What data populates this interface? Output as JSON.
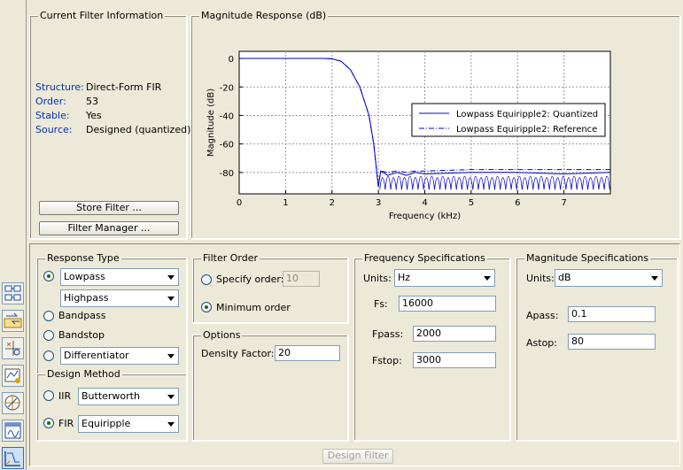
{
  "filter_info": {
    "title": "Current Filter Information",
    "rows": [
      {
        "key": "Structure:",
        "value": "Direct-Form FIR"
      },
      {
        "key": "Order:",
        "value": "53"
      },
      {
        "key": "Stable:",
        "value": "Yes"
      },
      {
        "key": "Source:",
        "value": "Designed (quantized)"
      }
    ],
    "store_filter_label": "Store Filter ...",
    "filter_manager_label": "Filter Manager ..."
  },
  "magnitude_panel": {
    "title": "Magnitude Response (dB)"
  },
  "chart_data": {
    "type": "line",
    "title": "",
    "xlabel": "Frequency (kHz)",
    "ylabel": "Magnitude (dB)",
    "xlim": [
      0,
      8
    ],
    "ylim": [
      -95,
      5
    ],
    "xticks": [
      "0",
      "1",
      "2",
      "3",
      "4",
      "5",
      "6",
      "7"
    ],
    "yticks": [
      "0",
      "-20",
      "-40",
      "-60",
      "-80"
    ],
    "grid": true,
    "legend_position": "center-right",
    "series": [
      {
        "name": "Lowpass Equiripple2: Quantized",
        "style": "solid",
        "color": "#0000cc",
        "x": [
          0,
          1,
          1.8,
          2.0,
          2.2,
          2.4,
          2.6,
          2.8,
          2.9,
          3.0,
          3.05,
          3.2,
          3.4,
          3.6,
          3.8,
          4.0,
          5.0,
          6.0,
          7.0,
          8.0
        ],
        "y": [
          0,
          0,
          0,
          -0.2,
          -2,
          -8,
          -20,
          -40,
          -60,
          -90,
          -79,
          -82,
          -80,
          -82,
          -80,
          -81,
          -80,
          -80,
          -81,
          -80
        ]
      },
      {
        "name": "Lowpass Equiripple2: Reference",
        "style": "dashdot",
        "color": "#0000cc",
        "x": [
          0,
          1,
          1.8,
          2.0,
          2.2,
          2.4,
          2.6,
          2.8,
          2.9,
          3.0,
          3.05,
          3.2,
          3.4,
          3.6,
          3.8,
          4.0,
          5.0,
          6.0,
          7.0,
          8.0
        ],
        "y": [
          0,
          0,
          0,
          -0.2,
          -2,
          -8,
          -20,
          -40,
          -60,
          -90,
          -79,
          -80,
          -79,
          -80,
          -79,
          -79,
          -78,
          -78,
          -78,
          -78
        ]
      }
    ]
  },
  "response_type": {
    "title": "Response Type",
    "lowpass": "Lowpass",
    "highpass": "Highpass",
    "bandpass": "Bandpass",
    "bandstop": "Bandstop",
    "differentiator": "Differentiator"
  },
  "design_method": {
    "title": "Design Method",
    "iir_label": "IIR",
    "iir_value": "Butterworth",
    "fir_label": "FIR",
    "fir_value": "Equiripple"
  },
  "filter_order": {
    "title": "Filter Order",
    "specify_label": "Specify order:",
    "specify_value": "10",
    "minimum_label": "Minimum order"
  },
  "options": {
    "title": "Options",
    "density_label": "Density Factor:",
    "density_value": "20"
  },
  "freq_specs": {
    "title": "Frequency Specifications",
    "units_label": "Units:",
    "units_value": "Hz",
    "fs_label": "Fs:",
    "fs_value": "16000",
    "fpass_label": "Fpass:",
    "fpass_value": "2000",
    "fstop_label": "Fstop:",
    "fstop_value": "3000"
  },
  "mag_specs": {
    "title": "Magnitude Specifications",
    "units_label": "Units:",
    "units_value": "dB",
    "apass_label": "Apass:",
    "apass_value": "0.1",
    "astop_label": "Astop:",
    "astop_value": "80"
  },
  "design_filter_label": "Design Filter",
  "toolbar_icons": [
    "filter-structure-icon",
    "transform-icon",
    "pole-zero-icon",
    "quantize-icon",
    "realize-model-icon",
    "import-icon",
    "design-filter-icon"
  ]
}
